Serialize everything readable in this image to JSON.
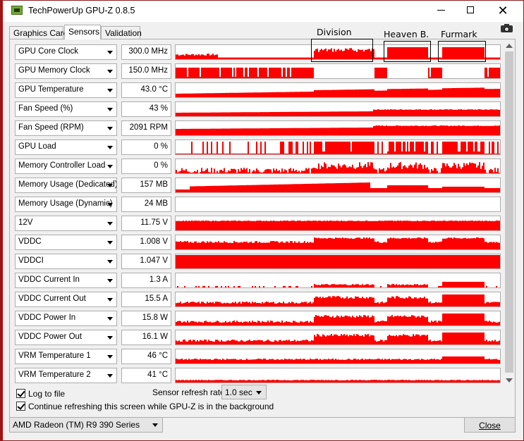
{
  "window": {
    "title": "TechPowerUp GPU-Z 0.8.5",
    "minimize_glyph": "",
    "maximize_glyph": "",
    "close_glyph": "✕"
  },
  "tabs": [
    {
      "label": "Graphics Card"
    },
    {
      "label": "Sensors"
    },
    {
      "label": "Validation"
    }
  ],
  "annotations": [
    {
      "label": "Division"
    },
    {
      "label": "Heaven B."
    },
    {
      "label": "Furmark"
    }
  ],
  "sensors": [
    {
      "name": "GPU Core Clock",
      "value": "300.0 MHz"
    },
    {
      "name": "GPU Memory Clock",
      "value": "150.0 MHz"
    },
    {
      "name": "GPU Temperature",
      "value": "43.0 °C"
    },
    {
      "name": "Fan Speed (%)",
      "value": "43 %"
    },
    {
      "name": "Fan Speed (RPM)",
      "value": "2091 RPM"
    },
    {
      "name": "GPU Load",
      "value": "0 %"
    },
    {
      "name": "Memory Controller Load",
      "value": "0 %"
    },
    {
      "name": "Memory Usage (Dedicated)",
      "value": "157 MB"
    },
    {
      "name": "Memory Usage (Dynamic)",
      "value": "24 MB"
    },
    {
      "name": "12V",
      "value": "11.75 V"
    },
    {
      "name": "VDDC",
      "value": "1.008 V"
    },
    {
      "name": "VDDCI",
      "value": "1.047 V"
    },
    {
      "name": "VDDC Current In",
      "value": "1.3 A"
    },
    {
      "name": "VDDC Current Out",
      "value": "15.5 A"
    },
    {
      "name": "VDDC Power In",
      "value": "15.8 W"
    },
    {
      "name": "VDDC Power Out",
      "value": "16.1 W"
    },
    {
      "name": "VRM Temperature 1",
      "value": "46 °C"
    },
    {
      "name": "VRM Temperature 2",
      "value": "41 °C"
    }
  ],
  "options": {
    "log_to_file": {
      "label": "Log to file",
      "checked": true
    },
    "continue_refreshing": {
      "label": "Continue refreshing this screen while GPU-Z is in the background",
      "checked": true
    },
    "refresh_rate_label": "Sensor refresh rate:",
    "refresh_rate_value": "1.0 sec"
  },
  "footer": {
    "gpu_select": "AMD Radeon (TM) R9 390 Series",
    "close_label": "Close"
  },
  "colors": {
    "graph": "#ff0000"
  }
}
